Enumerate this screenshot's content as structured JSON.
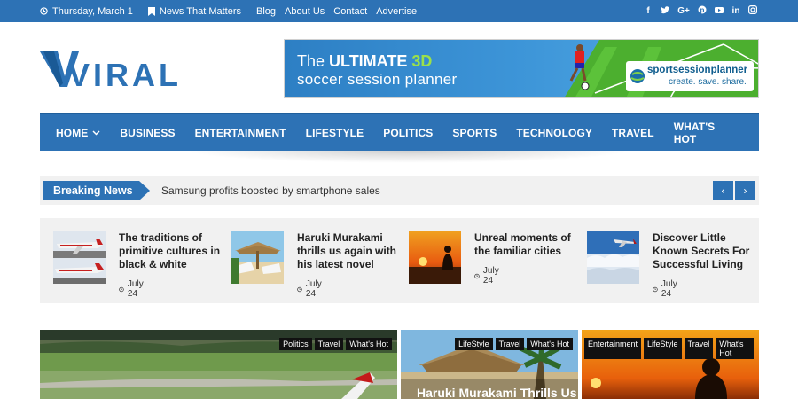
{
  "topbar": {
    "date": "Thursday, March 1",
    "tagline": "News That Matters",
    "links": [
      "Blog",
      "About Us",
      "Contact",
      "Advertise"
    ],
    "social_icons": [
      "facebook-icon",
      "twitter-icon",
      "google-plus-icon",
      "pinterest-icon",
      "youtube-icon",
      "linkedin-icon",
      "instagram-icon"
    ]
  },
  "logo": {
    "text": "VIRAL"
  },
  "banner": {
    "line1_prefix": "The ",
    "line1_bold": "ULTIMATE",
    "line1_3d": " 3D",
    "line2": "soccer session planner",
    "brand": "sportsessionplanner",
    "brand_tagline": "create. save. share."
  },
  "nav": {
    "items": [
      "HOME",
      "BUSINESS",
      "ENTERTAINMENT",
      "LIFESTYLE",
      "POLITICS",
      "SPORTS",
      "TECHNOLOGY",
      "TRAVEL",
      "WHAT'S HOT"
    ]
  },
  "breaking": {
    "label": "Breaking News",
    "text": "Samsung profits boosted by smartphone sales",
    "prev": "‹",
    "next": "›"
  },
  "featured": [
    {
      "title": "The traditions of primitive cultures in black & white",
      "date": "July 24"
    },
    {
      "title": "Haruki Murakami thrills us again with his latest novel",
      "date": "July 24"
    },
    {
      "title": "Unreal moments of the familiar cities",
      "date": "July 24"
    },
    {
      "title": "Discover Little Known Secrets For Successful Living",
      "date": "July 24"
    }
  ],
  "posts": [
    {
      "tags": [
        "Politics",
        "Travel",
        "What's Hot"
      ]
    },
    {
      "tags": [
        "LifeStyle",
        "Travel",
        "What's Hot"
      ],
      "title": "Haruki Murakami Thrills Us"
    },
    {
      "tags": [
        "Entertainment",
        "LifeStyle",
        "Travel",
        "What's Hot"
      ]
    }
  ],
  "colors": {
    "brand": "#2d72b5",
    "strip_bg": "#f1f1f1",
    "tag_bg": "#111111"
  }
}
